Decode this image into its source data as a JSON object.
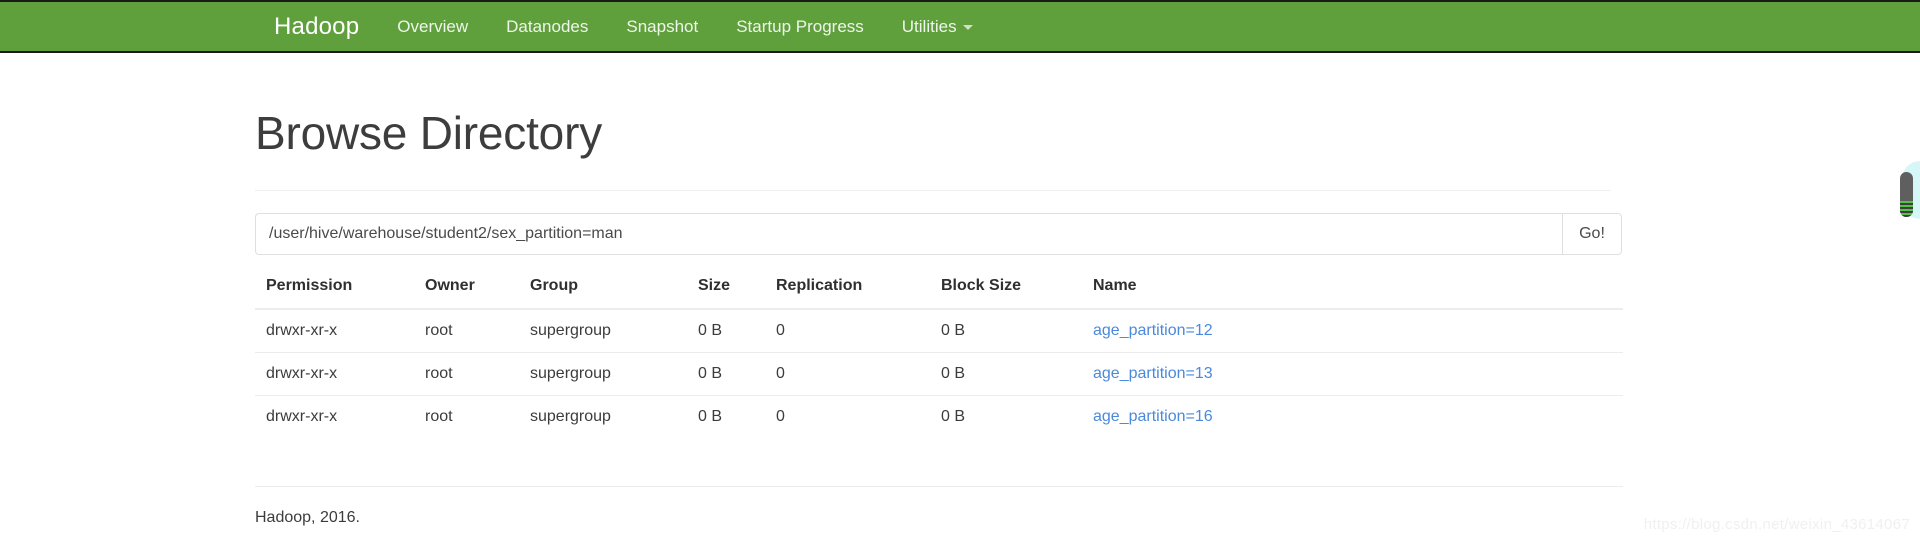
{
  "navbar": {
    "brand": "Hadoop",
    "items": [
      {
        "label": "Overview",
        "icon": null
      },
      {
        "label": "Datanodes",
        "icon": null
      },
      {
        "label": "Snapshot",
        "icon": null
      },
      {
        "label": "Startup Progress",
        "icon": null
      },
      {
        "label": "Utilities",
        "icon": "caret-down-icon"
      }
    ],
    "background_color": "#5fa03c",
    "text_color": "#ffffff"
  },
  "page": {
    "title": "Browse Directory"
  },
  "path_form": {
    "value": "/user/hive/warehouse/student2/sex_partition=man",
    "placeholder": "Enter path",
    "go_label": "Go!"
  },
  "table": {
    "headers": [
      "Permission",
      "Owner",
      "Group",
      "Size",
      "Replication",
      "Block Size",
      "Name"
    ],
    "rows": [
      {
        "permission": "drwxr-xr-x",
        "owner": "root",
        "group": "supergroup",
        "size": "0 B",
        "replication": "0",
        "block_size": "0 B",
        "name": "age_partition=12"
      },
      {
        "permission": "drwxr-xr-x",
        "owner": "root",
        "group": "supergroup",
        "size": "0 B",
        "replication": "0",
        "block_size": "0 B",
        "name": "age_partition=13"
      },
      {
        "permission": "drwxr-xr-x",
        "owner": "root",
        "group": "supergroup",
        "size": "0 B",
        "replication": "0",
        "block_size": "0 B",
        "name": "age_partition=16"
      }
    ],
    "link_color": "#4a89dc"
  },
  "footer": {
    "text": "Hadoop, 2016."
  },
  "watermark": {
    "text": "https://blog.csdn.net/weixin_43614067"
  }
}
